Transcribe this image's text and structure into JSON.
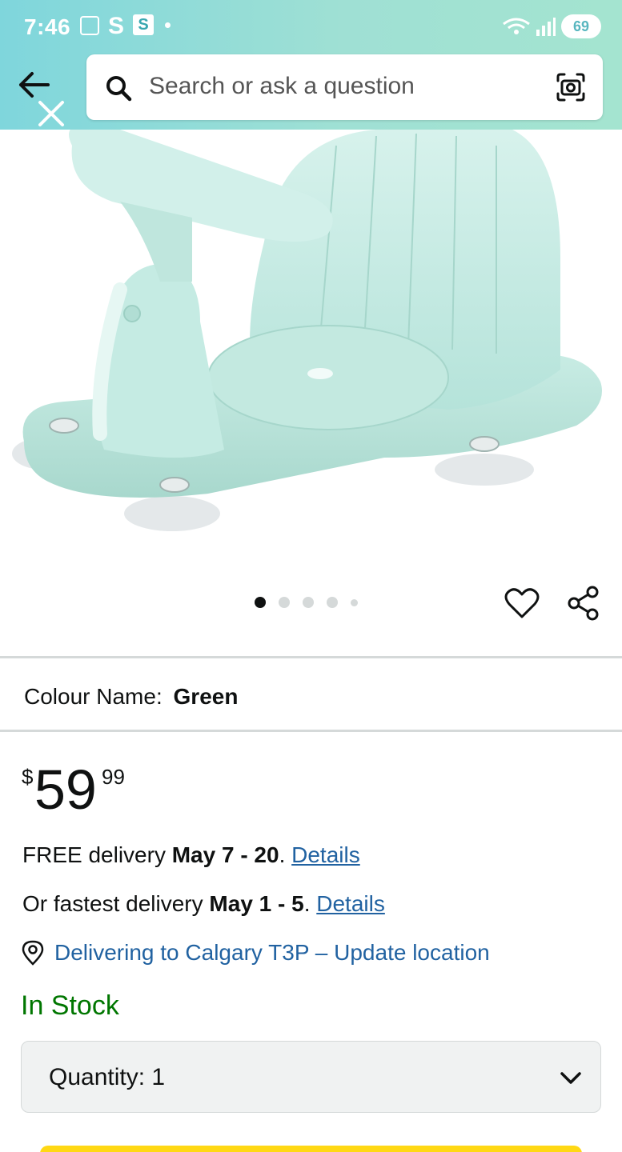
{
  "status_bar": {
    "time": "7:46",
    "s_label": "S",
    "s_box_label": "S",
    "battery": "69"
  },
  "header": {
    "back_icon": "arrow-left-icon",
    "close_icon": "close-icon",
    "search": {
      "placeholder": "Search or ask a question",
      "camera_icon": "camera-scan-icon"
    }
  },
  "gallery": {
    "image_alt": "Baby bath seat in mint green",
    "dots_total": 5,
    "active_dot": 0
  },
  "colour": {
    "label": "Colour Name:",
    "value": "Green"
  },
  "price": {
    "symbol": "$",
    "whole": "59",
    "fraction": "99"
  },
  "delivery": {
    "free_prefix": "FREE delivery",
    "free_dates": "May 7 - 20",
    "free_link": "Details",
    "fast_prefix": "Or fastest delivery",
    "fast_dates": "May 1 - 5",
    "fast_link": "Details",
    "location": "Delivering to Calgary T3P – Update location"
  },
  "stock": "In Stock",
  "quantity": {
    "label": "Quantity:",
    "value": "1"
  },
  "colors": {
    "header_start": "#7fd6dc",
    "header_end": "#a4e4d0",
    "link": "#2162a1",
    "in_stock": "#007600",
    "buy_button": "#ffd814"
  }
}
